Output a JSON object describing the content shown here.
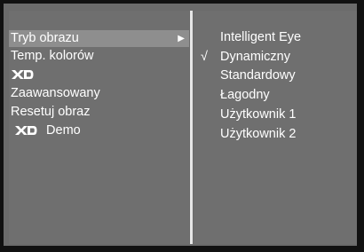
{
  "main_menu": {
    "items": [
      {
        "label": "Tryb obrazu",
        "selected": true,
        "has_submenu": true,
        "icon": "right-triangle-arrow"
      },
      {
        "label": "Temp. kolorów"
      },
      {
        "label": "",
        "icon": "xd-logo"
      },
      {
        "label": "Zaawansowany"
      },
      {
        "label": "Resetuj obraz"
      },
      {
        "label": "Demo",
        "icon": "xd-logo"
      }
    ]
  },
  "submenu": {
    "items": [
      {
        "label": "Intelligent Eye",
        "checked": false
      },
      {
        "label": "Dynamiczny",
        "checked": true,
        "check_mark": "√"
      },
      {
        "label": "Standardowy",
        "checked": false
      },
      {
        "label": "Łagodny",
        "checked": false
      },
      {
        "label": "Użytkownik 1",
        "checked": false
      },
      {
        "label": "Użytkownik 2",
        "checked": false
      }
    ]
  },
  "colors": {
    "panel": "#6f6f6f",
    "highlight": "#8e8e8e",
    "text": "#ffffff",
    "frame": "#111111",
    "divider": "#e6e6e6"
  }
}
